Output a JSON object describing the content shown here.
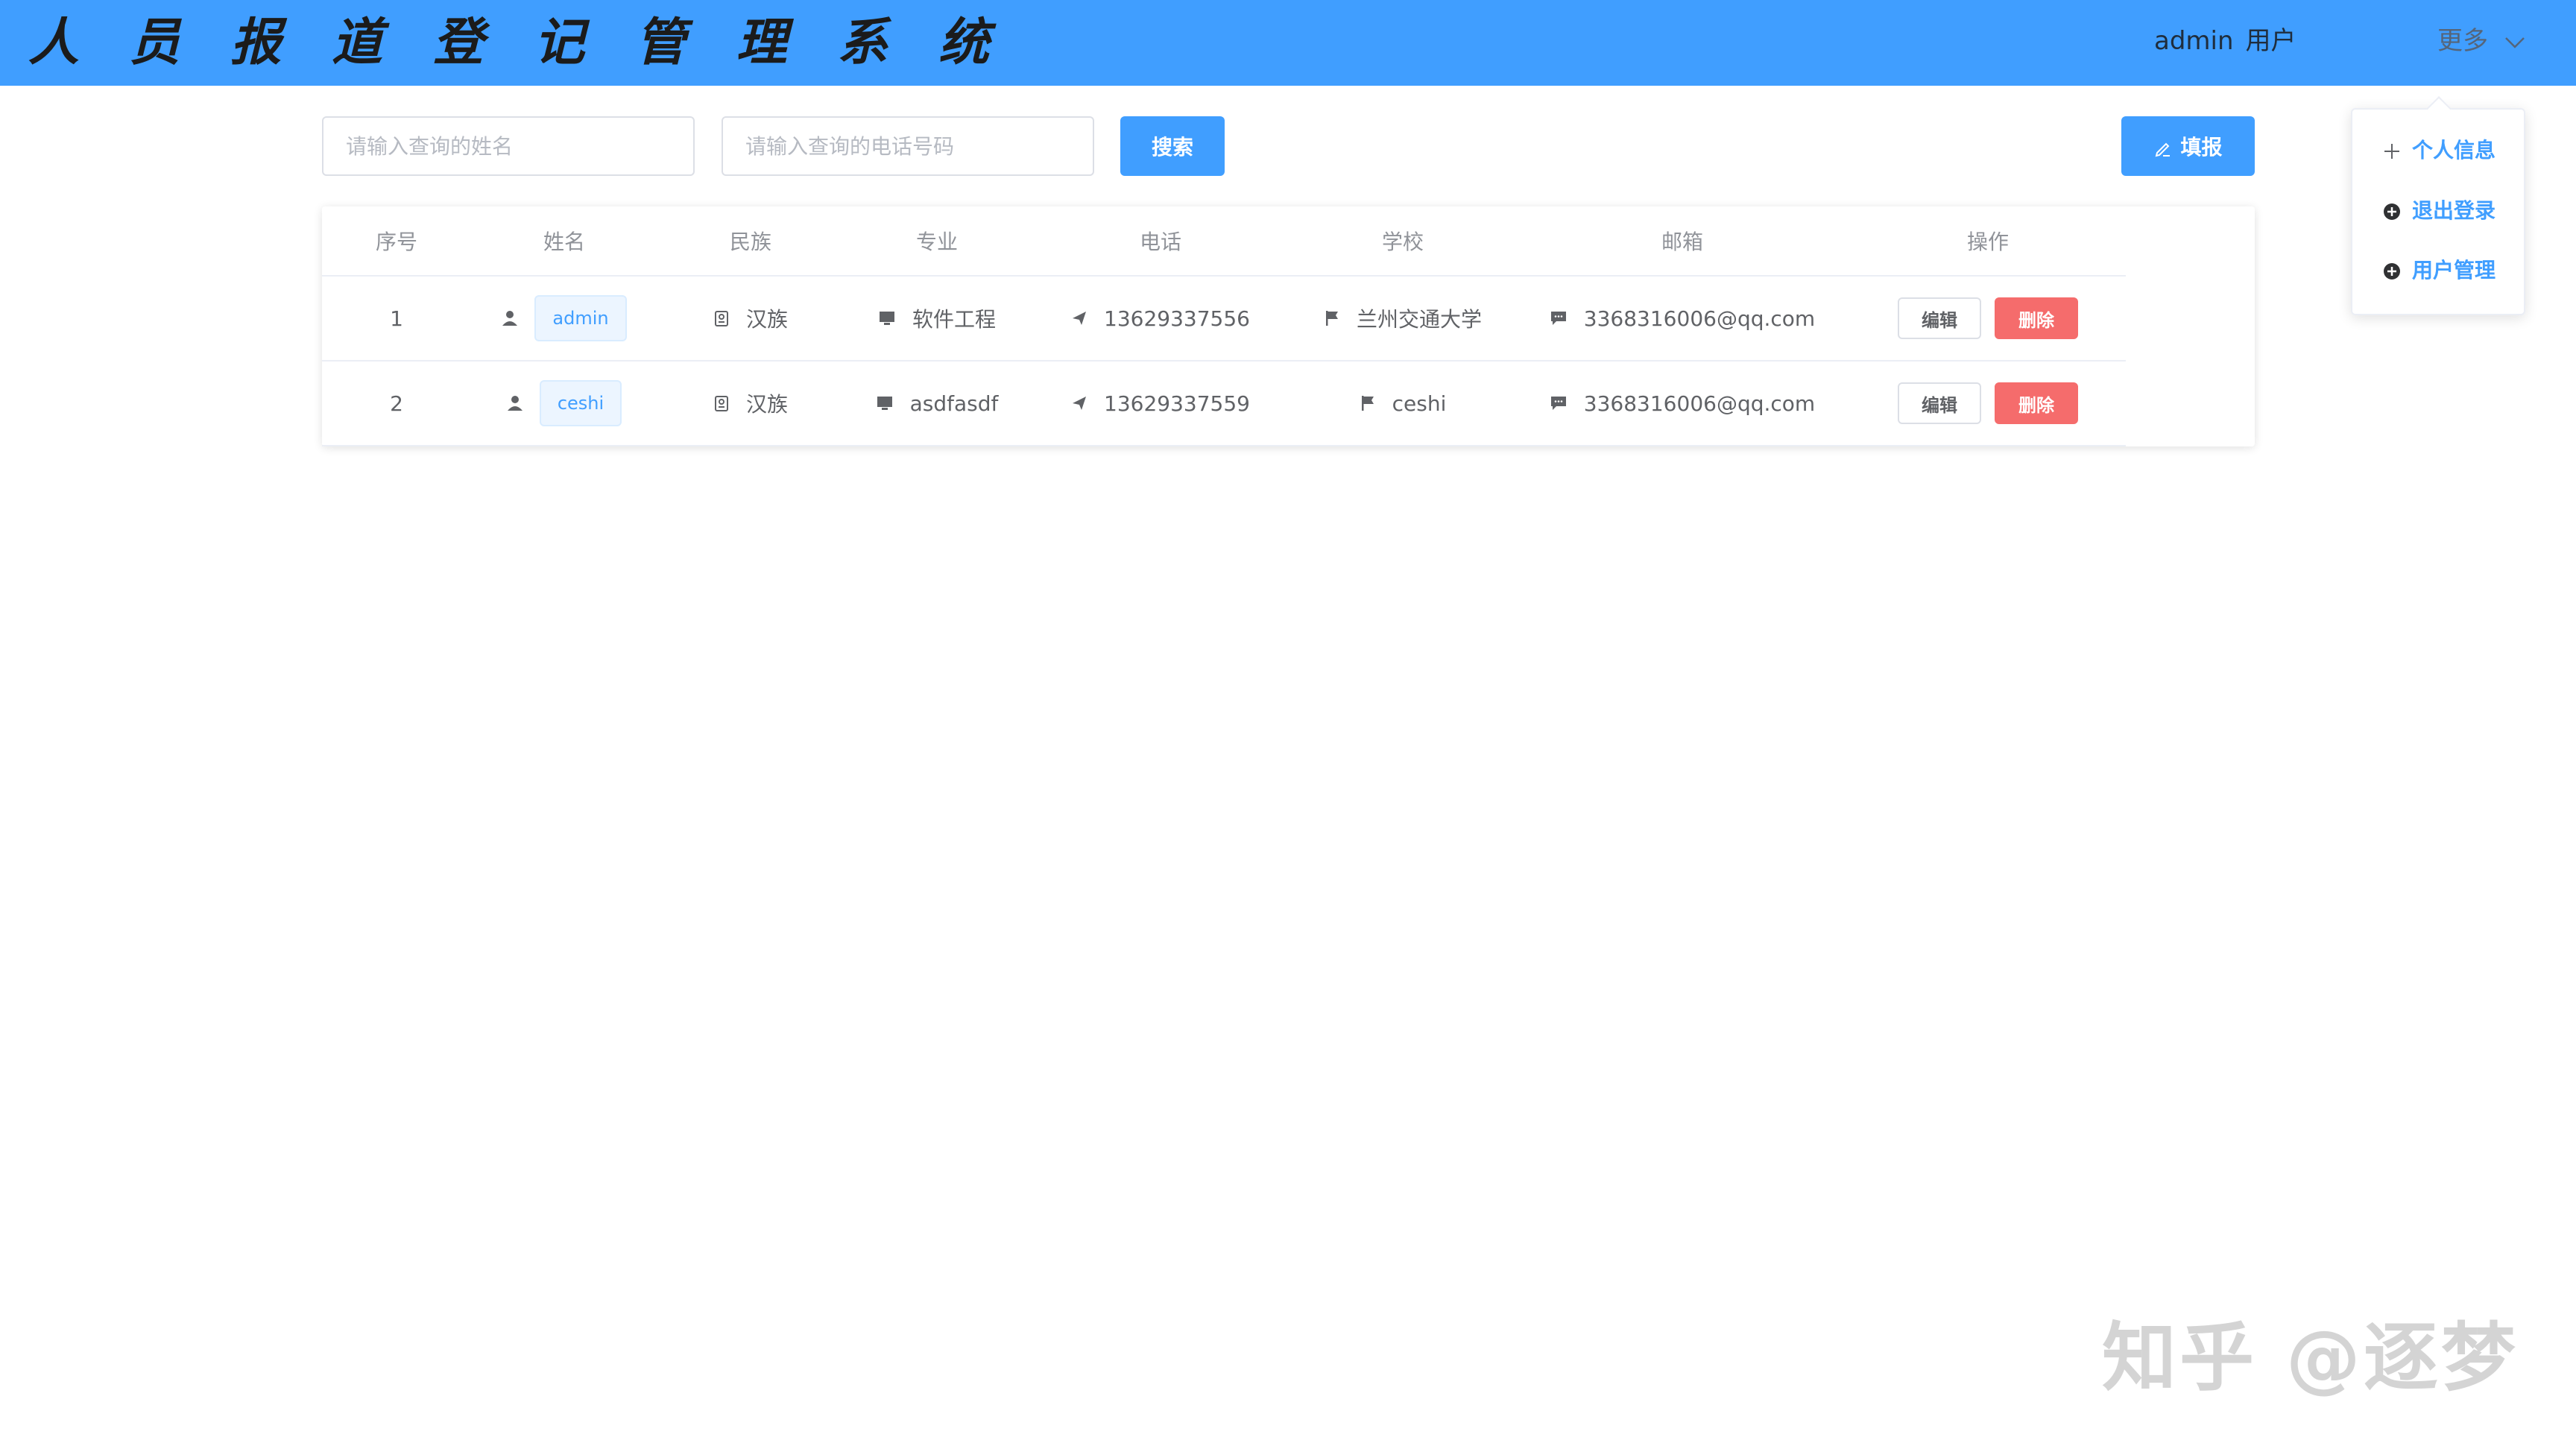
{
  "header": {
    "title": "人 员 报 道 登 记 管 理 系 统",
    "username": "admin",
    "role": "用户",
    "more_label": "更多"
  },
  "search": {
    "name_placeholder": "请输入查询的姓名",
    "phone_placeholder": "请输入查询的电话号码",
    "search_label": "搜索"
  },
  "toolbar": {
    "report_label": "填报"
  },
  "table": {
    "columns": [
      "序号",
      "姓名",
      "民族",
      "专业",
      "电话",
      "学校",
      "邮箱",
      "操作"
    ],
    "rows": [
      {
        "index": "1",
        "name": "admin",
        "nation": "汉族",
        "major": "软件工程",
        "phone": "13629337556",
        "school": "兰州交通大学",
        "email": "3368316006@qq.com"
      },
      {
        "index": "2",
        "name": "ceshi",
        "nation": "汉族",
        "major": "asdfasdf",
        "phone": "13629337559",
        "school": "ceshi",
        "email": "3368316006@qq.com"
      }
    ],
    "edit_label": "编辑",
    "delete_label": "删除"
  },
  "dropdown": {
    "items": [
      {
        "label": "个人信息",
        "icon": "plus-icon"
      },
      {
        "label": "退出登录",
        "icon": "circle-plus-icon"
      },
      {
        "label": "用户管理",
        "icon": "circle-plus-icon"
      }
    ]
  },
  "watermark": {
    "text": "知乎 @逐梦"
  },
  "colors": {
    "primary": "#409eff",
    "danger": "#f56c6c",
    "header_bg": "#409eff"
  }
}
